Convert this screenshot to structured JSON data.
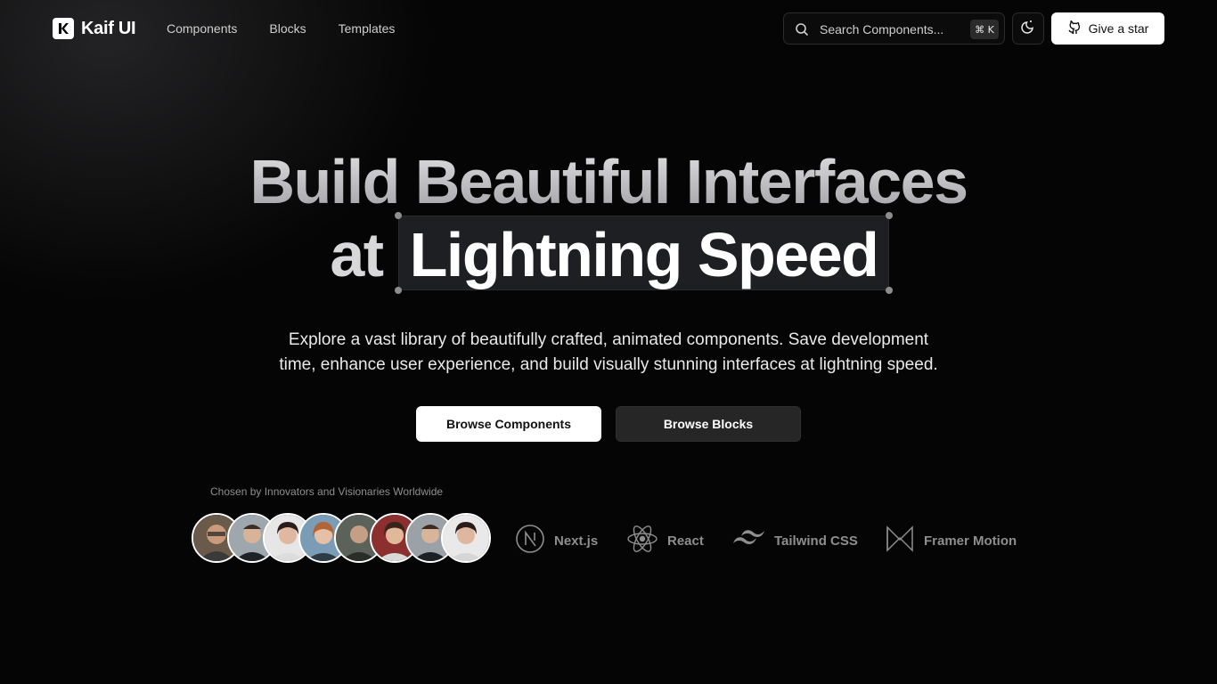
{
  "header": {
    "brand": "Kaif UI",
    "nav": [
      "Components",
      "Blocks",
      "Templates"
    ],
    "search_placeholder": "Search Components...",
    "search_shortcut": "⌘ K",
    "star_label": "Give a star"
  },
  "hero": {
    "line1": "Build Beautiful Interfaces",
    "line2_prefix": "at",
    "line2_highlight": "Lightning Speed",
    "subtitle_line1": "Explore a vast library of beautifully crafted, animated components. Save development",
    "subtitle_line2": "time, enhance user experience, and build visually stunning interfaces at lightning speed.",
    "primary_cta": "Browse Components",
    "secondary_cta": "Browse Blocks"
  },
  "social_proof": {
    "caption": "Chosen by Innovators and Visionaries Worldwide",
    "avatar_count": 8
  },
  "tech_stack": [
    {
      "name": "Next.js",
      "icon": "nextjs-icon"
    },
    {
      "name": "React",
      "icon": "react-icon"
    },
    {
      "name": "Tailwind CSS",
      "icon": "tailwind-icon"
    },
    {
      "name": "Framer Motion",
      "icon": "framer-motion-icon"
    }
  ],
  "colors": {
    "background": "#050505",
    "highlight_box": "#1e1f22",
    "muted_text": "#8e8e8e"
  }
}
